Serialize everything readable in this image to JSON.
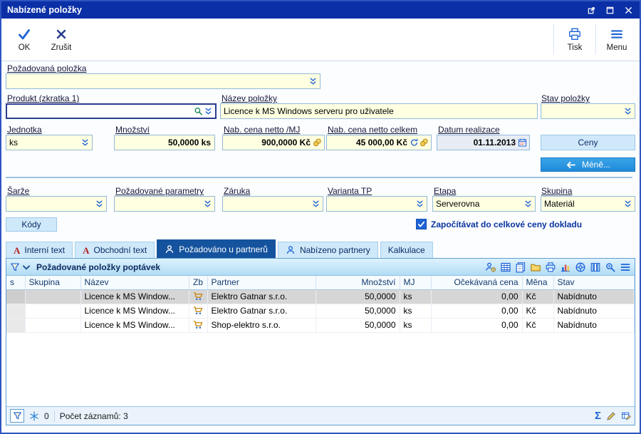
{
  "window": {
    "title": "Nabízené položky",
    "control_icons": [
      "window-restore-icon",
      "window-maximize-icon",
      "window-close-icon"
    ]
  },
  "colors": {
    "titlebar": "#0a2fa6",
    "accent": "#1e63d6",
    "field_bg": "#ffffe1",
    "tab_active": "#15539e",
    "selected_row": "#d6d6d6",
    "action_button": "#2e9ce4"
  },
  "toolbar": {
    "ok_label": "OK",
    "cancel_label": "Zrušit",
    "print_label": "Tisk",
    "menu_label": "Menu"
  },
  "form": {
    "requested_item_label": "Požadovaná položka",
    "requested_item_value": "",
    "product_label": "Produkt (zkratka 1)",
    "product_value": "",
    "name_label": "Název položky",
    "name_value": "Licence k MS Windows serveru pro uživatele",
    "state_label": "Stav položky",
    "state_value": "",
    "unit_label": "Jednotka",
    "unit_value": "ks",
    "qty_label": "Množství",
    "qty_value": "50,0000 ks",
    "price_unit_label": "Nab. cena netto /MJ",
    "price_unit_value": "900,0000 Kč",
    "price_total_label": "Nab. cena netto celkem",
    "price_total_value": "45 000,00 Kč",
    "date_label": "Datum realizace",
    "date_value": "01.11.2013",
    "prices_button": "Ceny",
    "less_button": "Méně...",
    "batch_label": "Šarže",
    "batch_value": "",
    "params_label": "Požadované parametry",
    "params_value": "",
    "warranty_label": "Záruka",
    "warranty_value": "",
    "variant_label": "Varianta TP",
    "variant_value": "",
    "stage_label": "Etapa",
    "stage_value": "Serverovna",
    "group_label": "Skupina",
    "group_value": "Materiál",
    "codes_button": "Kódy",
    "include_label": "Započítávat do celkové ceny dokladu",
    "include_checked": true
  },
  "tabs": [
    {
      "label": "Interní text",
      "icon": "a-letter-icon",
      "active": false
    },
    {
      "label": "Obchodní text",
      "icon": "a-letter-icon",
      "active": false
    },
    {
      "label": "Požadováno u partnerů",
      "icon": "person-icon",
      "active": true
    },
    {
      "label": "Nabízeno partnery",
      "icon": "person-icon",
      "active": false
    },
    {
      "label": "Kalkulace",
      "icon": "",
      "active": false
    }
  ],
  "panel": {
    "title": "Požadované položky poptávek",
    "left_icons": [
      "funnel-icon",
      "chevron-down-icon"
    ],
    "toolbar_icons": [
      "user-gear-icon",
      "spreadsheet-icon",
      "document-copy-icon",
      "folder-icon",
      "printer-icon",
      "chart-icon",
      "wheel-icon",
      "columns-icon",
      "settings-search-icon",
      "list-menu-icon"
    ]
  },
  "table": {
    "columns": [
      "s",
      "Skupina",
      "Název",
      "Zb",
      "Partner",
      "Množství",
      "MJ",
      "Očekávaná cena",
      "Měna",
      "Stav"
    ],
    "rows": [
      {
        "selected": true,
        "cells": [
          "",
          "",
          "Licence k MS Window...",
          "cart-icon",
          "Elektro Gatnar s.r.o.",
          "50,0000",
          "ks",
          "0,00",
          "Kč",
          "Nabídnuto"
        ]
      },
      {
        "selected": false,
        "cells": [
          "",
          "",
          "Licence k MS Window...",
          "cart-icon",
          "Elektro Gatnar s.r.o.",
          "50,0000",
          "ks",
          "0,00",
          "Kč",
          "Nabídnuto"
        ]
      },
      {
        "selected": false,
        "cells": [
          "",
          "",
          "Licence k MS Window...",
          "cart-icon",
          "Shop-elektro s.r.o.",
          "50,0000",
          "ks",
          "0,00",
          "Kč",
          "Nabídnuto"
        ]
      }
    ]
  },
  "statusbar": {
    "filter_count": "0",
    "records_label": "Počet záznamů: 3",
    "left_icons": [
      "funnel-icon",
      "snowflake-icon"
    ],
    "right_icons": [
      "sum-icon",
      "pencil-icon",
      "grid-edit-icon"
    ]
  }
}
